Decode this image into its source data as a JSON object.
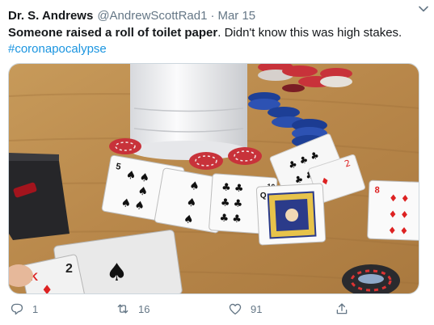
{
  "tweet": {
    "display_name": "Dr. S. Andrews",
    "handle": "@AndrewScottRad1",
    "separator": "·",
    "date": "Mar 15",
    "text_bold": "Someone raised a roll of toilet paper",
    "text_rest": ". Didn't know this was high stakes. ",
    "hashtag": "#coronapocalypse"
  },
  "media": {
    "card_labels": {
      "five": "5",
      "three": "3",
      "ten": "10",
      "queen": "Q",
      "two": "2",
      "eight": "8",
      "king": "K"
    }
  },
  "actions": {
    "reply_count": "1",
    "retweet_count": "16",
    "like_count": "91"
  },
  "colors": {
    "text_primary": "#14171a",
    "text_secondary": "#657786",
    "link": "#1b95e0"
  }
}
